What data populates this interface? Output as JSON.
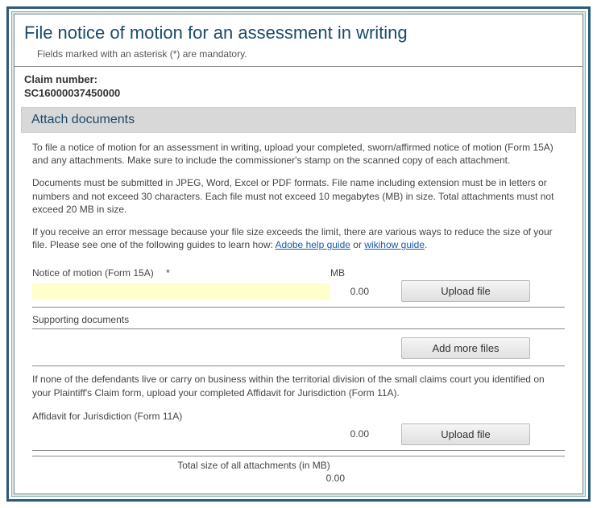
{
  "header": {
    "title": "File notice of motion for an assessment in writing",
    "mandatory_note": "Fields marked with an asterisk (*) are mandatory."
  },
  "claim": {
    "label": "Claim number:",
    "value": "SC16000037450000"
  },
  "section": {
    "title": "Attach documents"
  },
  "instructions": {
    "p1": "To file a notice of motion for an assessment in writing, upload your completed, sworn/affirmed notice of motion (Form 15A) and any attachments. Make sure to include the commissioner's stamp on the scanned copy of each attachment.",
    "p2": "Documents must be submitted in JPEG, Word, Excel or PDF formats. File name including extension must be in letters or numbers and not exceed 30 characters. Each file must not exceed 10 megabytes (MB) in size. Total attachments must not exceed 20 MB in size.",
    "p3_before": "If you receive an error message because your file size exceeds the limit, there are various ways to reduce the size of your file. Please see one of the following guides to learn how: ",
    "link1": "Adobe help guide",
    "p3_mid": " or ",
    "link2": "wikihow guide",
    "p3_end": "."
  },
  "uploads": {
    "mb_label": "MB",
    "notice": {
      "label": "Notice of motion (Form 15A)",
      "asterisk": "*",
      "size": "0.00",
      "button": "Upload file"
    },
    "supporting_label": "Supporting documents",
    "add_more": "Add more files",
    "conditional": "If none of the defendants live or carry on business within the territorial division of the small claims court you identified on your Plaintiff's Claim form, upload your completed Affidavit for Jurisdiction (Form 11A).",
    "affidavit": {
      "label": "Affidavit for Jurisdiction (Form 11A)",
      "size": "0.00",
      "button": "Upload file"
    },
    "total": {
      "label": "Total size of all attachments (in MB)",
      "value": "0.00"
    }
  }
}
